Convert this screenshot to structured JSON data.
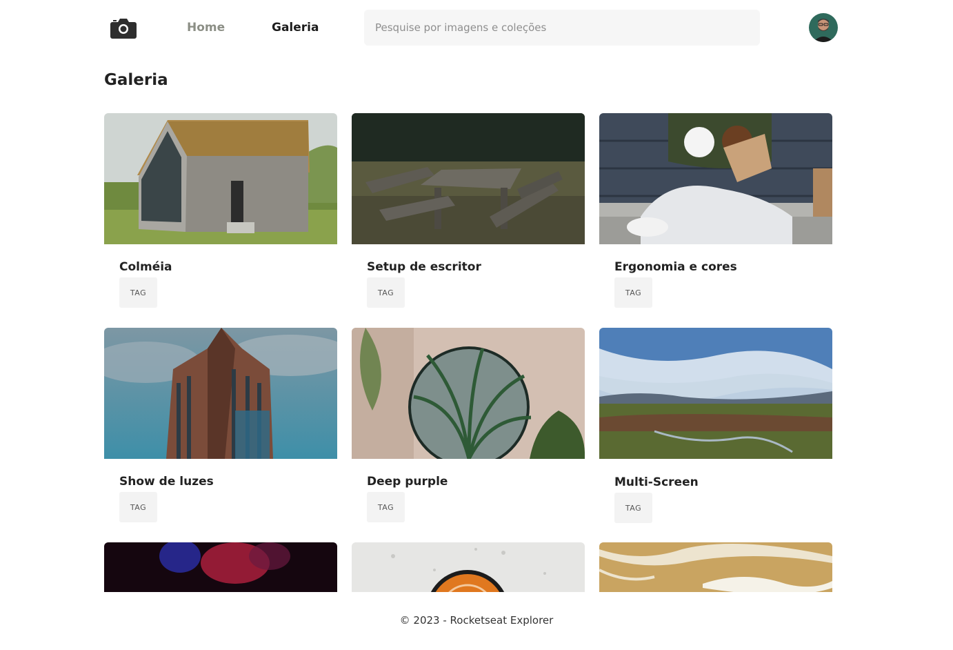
{
  "header": {
    "logo_icon": "camera-icon",
    "nav": {
      "home": "Home",
      "gallery": "Galeria"
    },
    "search_placeholder": "Pesquise por imagens e coleções",
    "avatar_icon": "user-avatar"
  },
  "page_title": "Galeria",
  "cards": [
    {
      "title": "Colméia",
      "tag": "TAG",
      "image": "wooden-cabin-grass-roof"
    },
    {
      "title": "Setup de escritor",
      "tag": "TAG",
      "image": "picnic-table"
    },
    {
      "title": "Ergonomia e cores",
      "tag": "TAG",
      "image": "person-coffee-donut"
    },
    {
      "title": "Show de luzes",
      "tag": "TAG",
      "image": "tall-building-sky"
    },
    {
      "title": "Deep purple",
      "tag": "TAG",
      "image": "mirror-palm-plant"
    },
    {
      "title": "Multi-Screen",
      "tag": "TAG",
      "image": "field-sky-clouds"
    },
    {
      "title": "",
      "tag": "",
      "image": "dark-smoke-colors"
    },
    {
      "title": "",
      "tag": "",
      "image": "snow-orange-object"
    },
    {
      "title": "",
      "tag": "",
      "image": "beach-sand-foam"
    }
  ],
  "footer": {
    "text": "© 2023 - Rocketseat Explorer"
  }
}
